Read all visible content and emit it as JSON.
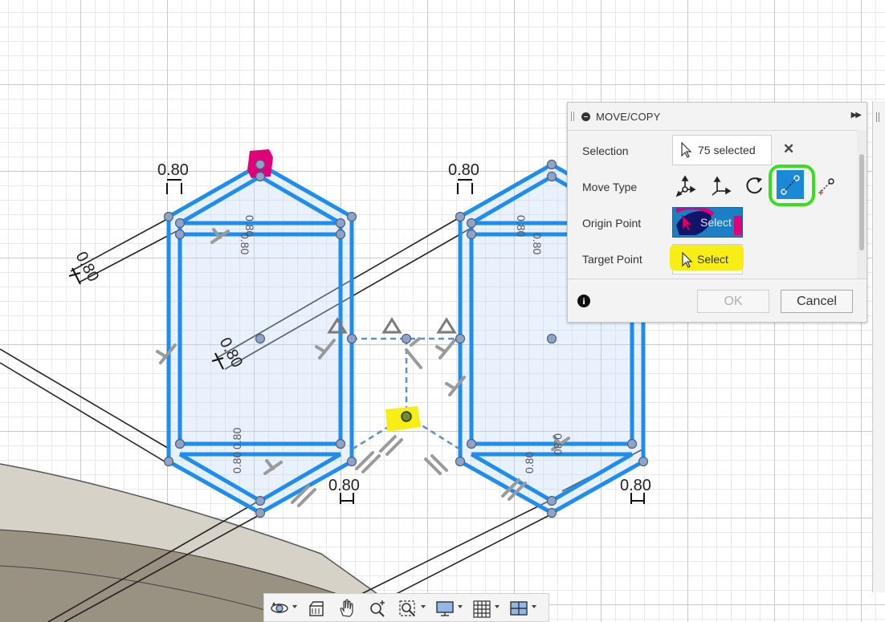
{
  "dialog": {
    "title": "MOVE/COPY",
    "selection_label": "Selection",
    "selection_value": "75 selected",
    "move_type_label": "Move Type",
    "move_types": [
      "free-move-icon",
      "translate-icon",
      "rotate-icon",
      "point-to-point-icon",
      "point-to-position-icon"
    ],
    "active_move_type": "point-to-point-icon",
    "origin_label": "Origin Point",
    "origin_button": "Select",
    "target_label": "Target Point",
    "target_button": "Select",
    "ok": "OK",
    "cancel": "Cancel"
  },
  "sketch": {
    "dimensions": [
      "0.80",
      "0.80",
      "0.80",
      "0.80",
      "0.80",
      "0.80",
      "0.80",
      "0.80"
    ],
    "highlight_colors": {
      "origin": "#e0007a",
      "target": "#f7ee16",
      "active_ring": "#38e01c"
    }
  },
  "nav_bar": {
    "items": [
      "orbit-icon",
      "look-at-icon",
      "pan-icon",
      "zoom-icon",
      "fit-icon",
      "display-settings-icon",
      "grid-icon",
      "viewports-icon"
    ]
  }
}
